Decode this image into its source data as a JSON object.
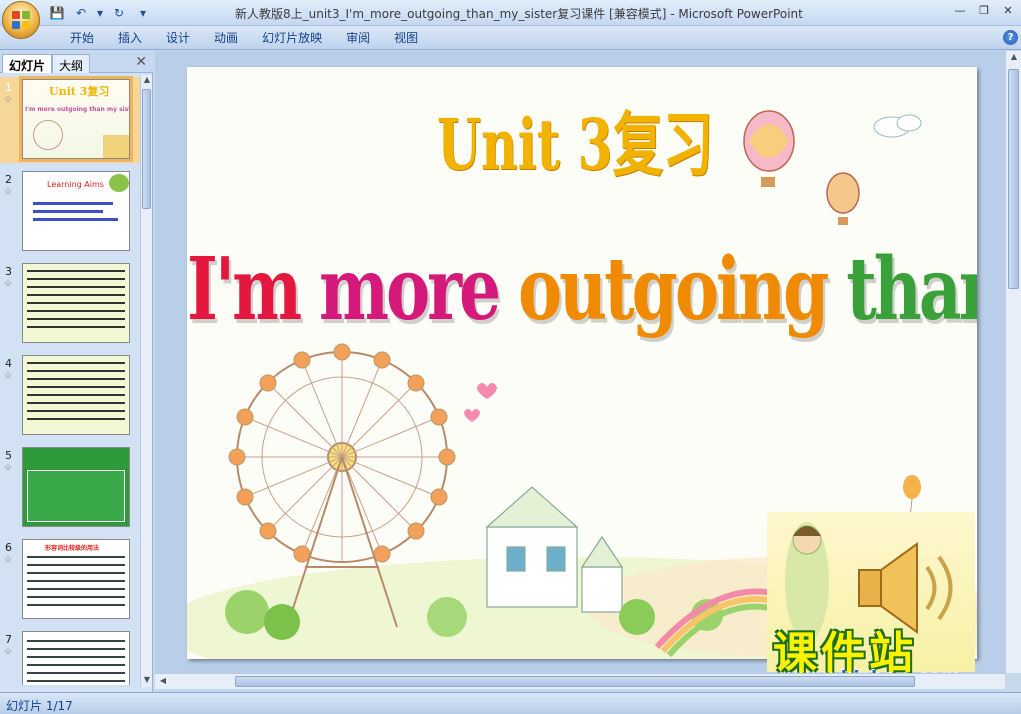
{
  "window": {
    "title": "新人教版8上_unit3_I'm_more_outgoing_than_my_sister复习课件 [兼容模式] - Microsoft PowerPoint",
    "minimize": "—",
    "restore": "❐",
    "close": "✕"
  },
  "qat": {
    "save": "💾",
    "undo": "↶",
    "undo_drop": "▾",
    "redo": "↻",
    "more": "▾"
  },
  "ribbon": {
    "tabs": [
      "开始",
      "插入",
      "设计",
      "动画",
      "幻灯片放映",
      "审阅",
      "视图"
    ],
    "help": "?"
  },
  "pane": {
    "tab_slides": "幻灯片",
    "tab_outline": "大纲",
    "close": "✕",
    "thumbnails": [
      {
        "num": "1",
        "title": "Unit 3复习",
        "subtitle": "I'm more outgoing than my sister."
      },
      {
        "num": "2",
        "title": "Learning Aims"
      },
      {
        "num": "3"
      },
      {
        "num": "4"
      },
      {
        "num": "5"
      },
      {
        "num": "6",
        "title": "形容词比较级的用法"
      },
      {
        "num": "7"
      }
    ],
    "star": "☆"
  },
  "slide": {
    "title": "Unit 3复习",
    "subtitle_words": [
      {
        "text": "I'm ",
        "color": "#e4183f"
      },
      {
        "text": "more ",
        "color": "#d5197a"
      },
      {
        "text": "outgoing ",
        "color": "#f08a00"
      },
      {
        "text": "than ",
        "color": "#3aa03a"
      },
      {
        "text": "my ",
        "color": "#2a3fb5"
      },
      {
        "text": "sister.",
        "color": "#8a1ea8"
      }
    ]
  },
  "watermark": {
    "text": "课件站",
    "url": "www.kjzhan.com"
  },
  "status": {
    "slide_counter": "幻灯片 1/17"
  }
}
